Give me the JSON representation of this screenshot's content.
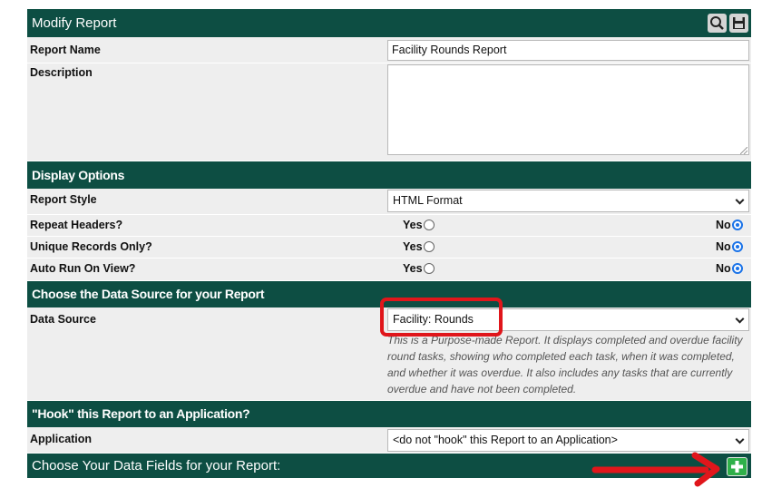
{
  "header": {
    "title": "Modify Report",
    "search_icon": "search-icon",
    "save_icon": "save-disk-icon"
  },
  "report_name": {
    "label": "Report Name",
    "value": "Facility Rounds Report"
  },
  "description": {
    "label": "Description",
    "value": ""
  },
  "display_options": {
    "title": "Display Options",
    "report_style": {
      "label": "Report Style",
      "value": "HTML Format"
    },
    "repeat_headers": {
      "label": "Repeat Headers?",
      "yes": "Yes",
      "no": "No",
      "selected": "No"
    },
    "unique_records": {
      "label": "Unique Records Only?",
      "yes": "Yes",
      "no": "No",
      "selected": "No"
    },
    "auto_run": {
      "label": "Auto Run On View?",
      "yes": "Yes",
      "no": "No",
      "selected": "No"
    }
  },
  "data_source_section": {
    "title": "Choose the Data Source for your Report",
    "label": "Data Source",
    "value": "Facility: Rounds",
    "help_text": "This is a Purpose-made Report. It displays completed and overdue facility round tasks, showing who completed each task, when it was completed, and whether it was overdue. It also includes any tasks that are currently overdue and have not been completed."
  },
  "hook_section": {
    "title": "\"Hook\" this Report to an Application?",
    "label": "Application",
    "value": "<do not \"hook\" this Report to an Application>"
  },
  "data_fields_section": {
    "title": "Choose Your Data Fields for your Report:",
    "add_icon": "plus-icon"
  },
  "colors": {
    "header_bg": "#0d4e43",
    "row_bg": "#eeeeee",
    "highlight": "#e0161b",
    "add_button": "#2fb04a",
    "radio_selected": "#1a73e8"
  }
}
